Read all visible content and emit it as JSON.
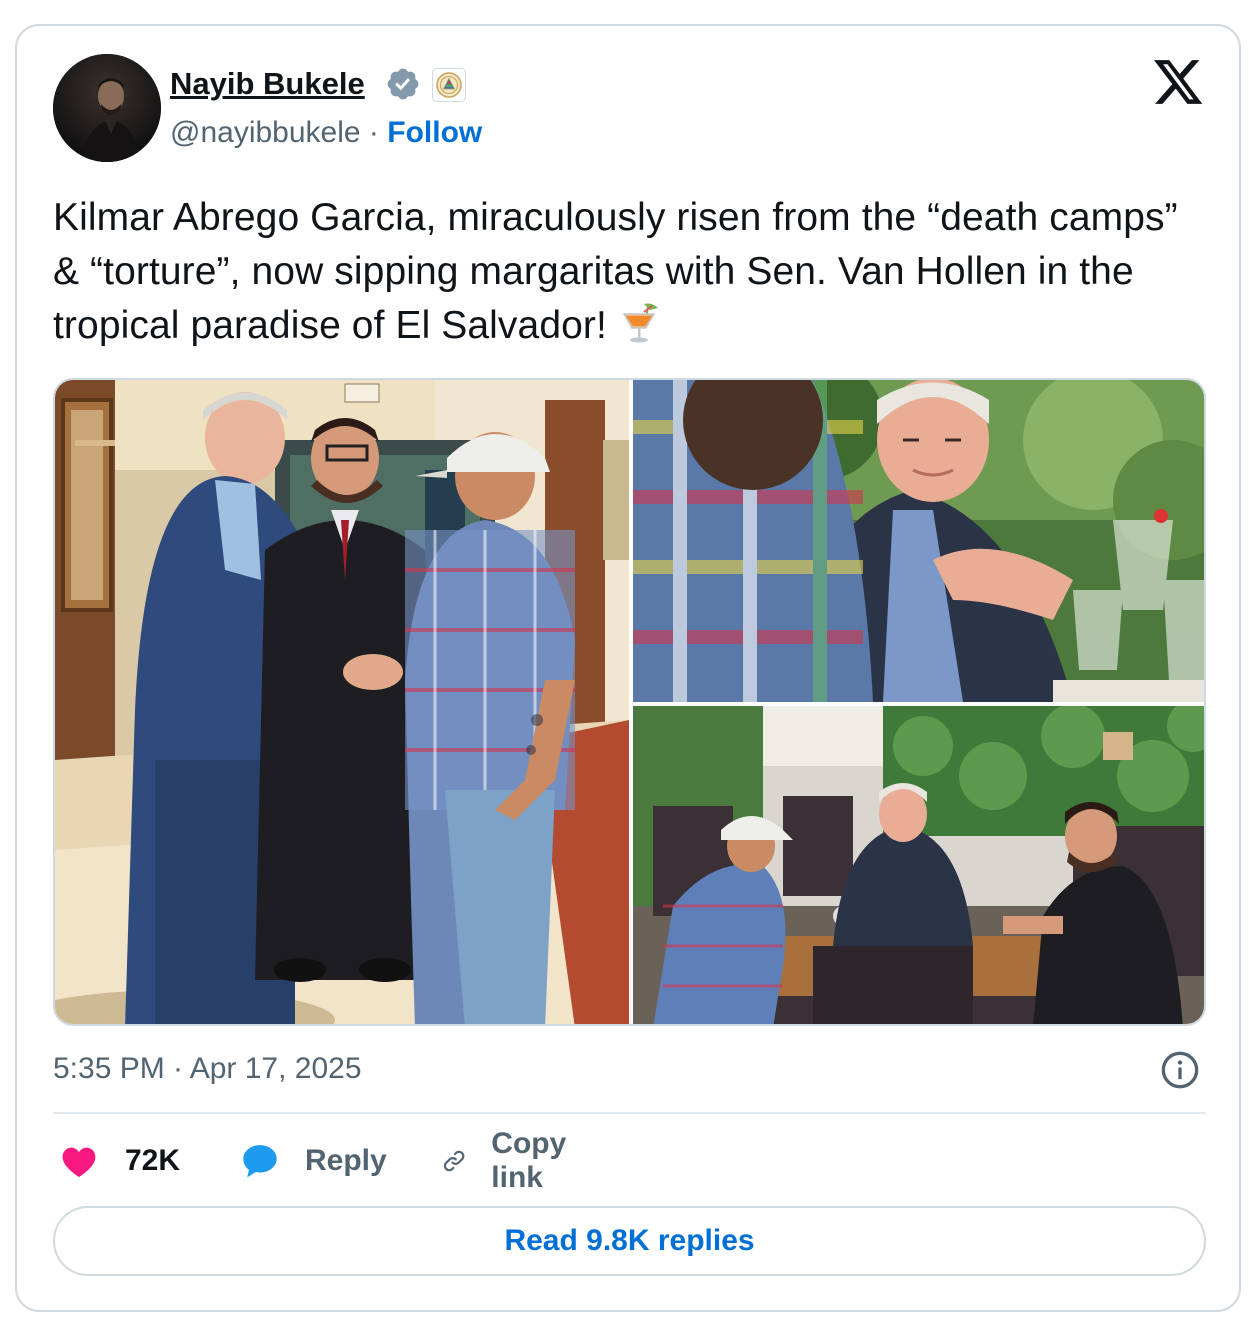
{
  "author": {
    "name": "Nayib Bukele",
    "handle": "@nayibbukele",
    "separator": "·",
    "follow_label": "Follow",
    "avatar_icon": "profile-photo",
    "verified_icon": "verified-badge-icon",
    "affiliate_icon": "el-salvador-seal-icon"
  },
  "tweet": {
    "text": "Kilmar Abrego Garcia, miraculously risen from the “death camps” & “torture”, now sipping margaritas with Sen. Van Hollen in the tropical paradise of El Salvador!",
    "emoji_icon": "tropical-drink-icon"
  },
  "media": {
    "count": 3,
    "photos": [
      {
        "icon": "photo-handshake-hotel-lobby"
      },
      {
        "icon": "photo-closeup-senator-at-table"
      },
      {
        "icon": "photo-restaurant-table-meeting"
      }
    ]
  },
  "meta": {
    "timestamp": "5:35 PM · Apr 17, 2025",
    "info_icon": "info-icon"
  },
  "actions": {
    "likes": "72K",
    "reply_label": "Reply",
    "copy_label": "Copy link"
  },
  "read_replies_label": "Read 9.8K replies",
  "colors": {
    "accent": "#006fd6",
    "like": "#f91880",
    "reply": "#1d9bf0",
    "secondary_text": "#536471",
    "border": "#cfd9de",
    "verified": "#829aab"
  }
}
